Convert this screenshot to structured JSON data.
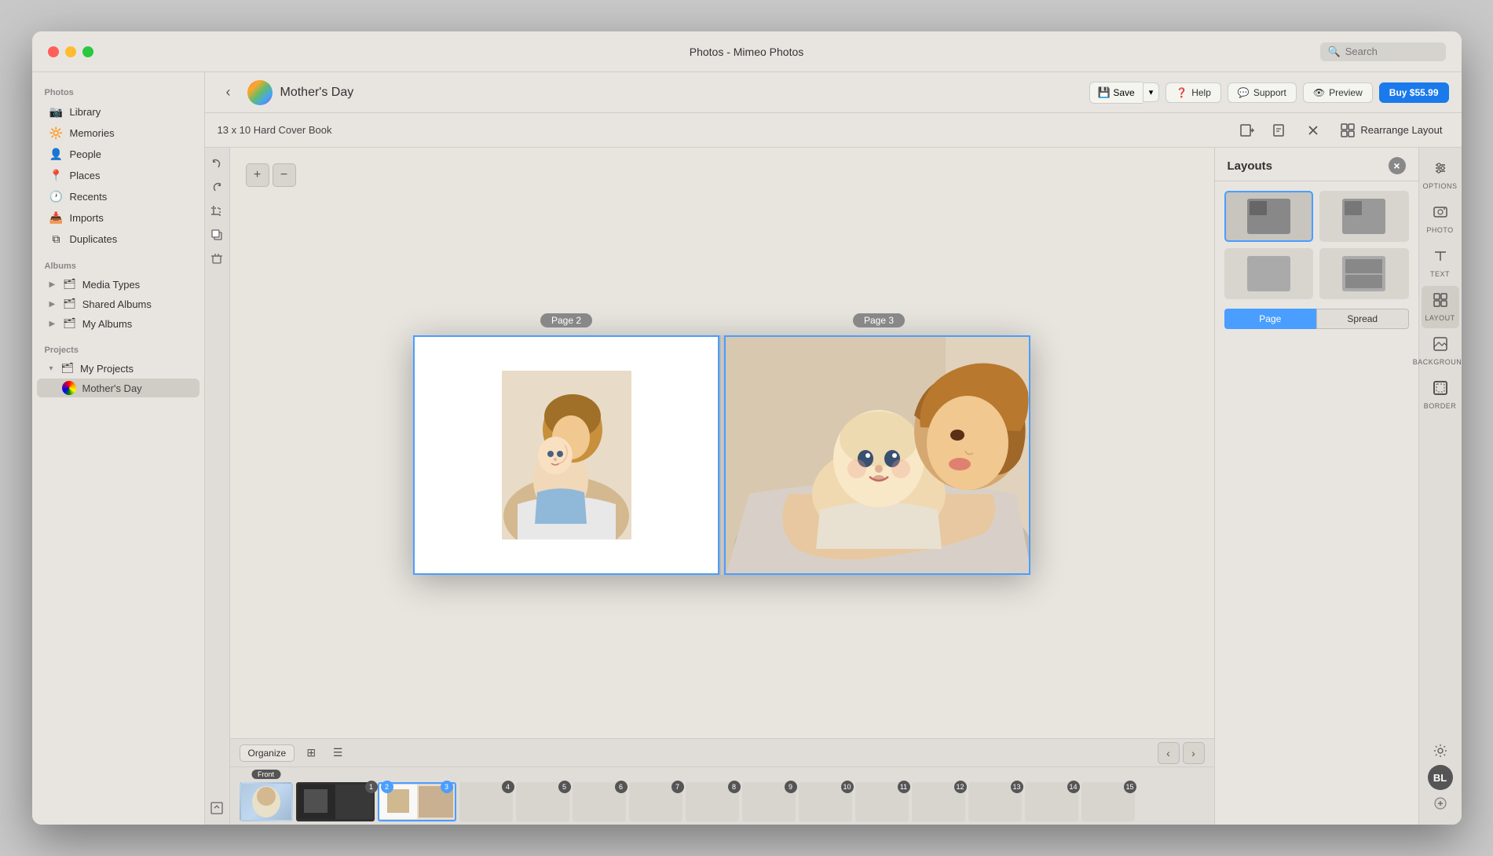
{
  "window": {
    "title": "Photos - Mimeo Photos"
  },
  "titlebar": {
    "title": "Photos - Mimeo Photos",
    "search_placeholder": "Search"
  },
  "toolbar": {
    "back_icon": "‹",
    "project_title": "Mother's Day",
    "save_label": "Save",
    "save_arrow": "▾",
    "help_label": "Help",
    "support_label": "Support",
    "preview_label": "Preview",
    "buy_label": "Buy $55.99"
  },
  "secondary_toolbar": {
    "book_spec": "13 x 10 Hard Cover Book",
    "rearrange_label": "Rearrange Layout"
  },
  "sidebar": {
    "photos_label": "Photos",
    "items": [
      {
        "id": "library",
        "label": "Library",
        "icon": "📷"
      },
      {
        "id": "memories",
        "label": "Memories",
        "icon": "🔆"
      },
      {
        "id": "people",
        "label": "People",
        "icon": "👤"
      },
      {
        "id": "places",
        "label": "Places",
        "icon": "📍"
      },
      {
        "id": "recents",
        "label": "Recents",
        "icon": "🕐"
      },
      {
        "id": "imports",
        "label": "Imports",
        "icon": "📥"
      },
      {
        "id": "duplicates",
        "label": "Duplicates",
        "icon": "⧉"
      }
    ],
    "albums_label": "Albums",
    "album_items": [
      {
        "id": "media-types",
        "label": "Media Types",
        "icon": "▶",
        "hasArrow": true
      },
      {
        "id": "shared-albums",
        "label": "Shared Albums",
        "icon": "▶",
        "hasArrow": true
      },
      {
        "id": "my-albums",
        "label": "My Albums",
        "icon": "▶",
        "hasArrow": true
      }
    ],
    "projects_label": "Projects",
    "project_items": [
      {
        "id": "my-projects",
        "label": "My Projects",
        "expanded": true
      },
      {
        "id": "mothers-day",
        "label": "Mother's Day",
        "active": true
      }
    ]
  },
  "canvas": {
    "page2_label": "Page 2",
    "page3_label": "Page 3"
  },
  "right_panel": {
    "title": "Layouts",
    "page_tab": "Page",
    "spread_tab": "Spread",
    "close_icon": "×"
  },
  "right_icons": {
    "options_label": "OPTIONS",
    "photo_label": "PHOTO",
    "text_label": "TEXT",
    "layout_label": "LAYOUT",
    "background_label": "BACKGROUND",
    "border_label": "BORDER"
  },
  "filmstrip": {
    "organize_label": "Organize",
    "prev_icon": "‹",
    "next_icon": "›",
    "pages": [
      {
        "num": "Front",
        "type": "front",
        "style": "blue"
      },
      {
        "num": "1",
        "style": "dark",
        "two_page": true
      },
      {
        "num": "2",
        "style": "selected",
        "badge": "2",
        "badge_color": "blue",
        "badge2": "3",
        "badge2_color": "blue"
      },
      {
        "num": "4",
        "style": "empty"
      },
      {
        "num": "5",
        "style": "empty"
      },
      {
        "num": "6",
        "style": "empty"
      },
      {
        "num": "7",
        "style": "empty"
      },
      {
        "num": "8",
        "style": "empty"
      },
      {
        "num": "9",
        "style": "empty"
      },
      {
        "num": "10",
        "style": "empty"
      },
      {
        "num": "11",
        "style": "empty"
      },
      {
        "num": "12",
        "style": "empty"
      },
      {
        "num": "13",
        "style": "empty"
      },
      {
        "num": "14",
        "style": "empty"
      },
      {
        "num": "15",
        "style": "empty"
      }
    ]
  }
}
